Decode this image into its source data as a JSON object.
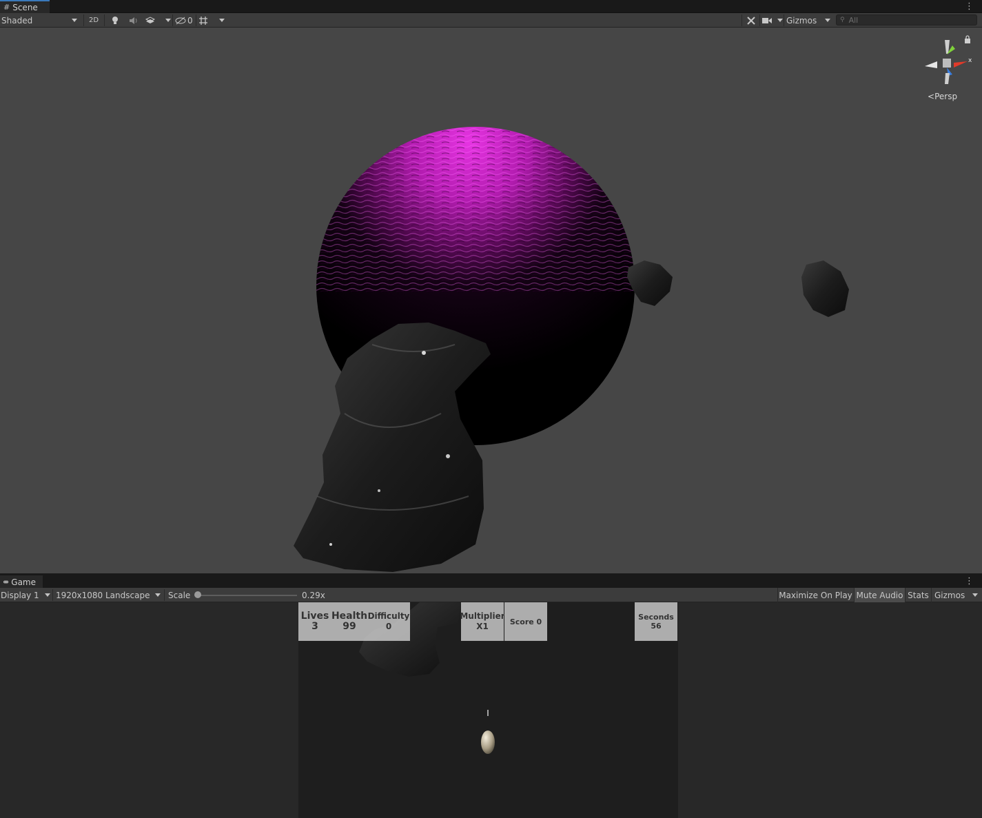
{
  "scene_panel": {
    "tab_label": "Scene",
    "toolbar": {
      "draw_mode": "Shaded",
      "mode_2d": "2D",
      "hidden_count": "0",
      "gizmos_label": "Gizmos",
      "search_placeholder": "All"
    },
    "view": {
      "projection_label": "Persp",
      "axis_x_label": "x"
    }
  },
  "game_panel": {
    "tab_label": "Game",
    "toolbar": {
      "display": "Display 1",
      "resolution": "1920x1080 Landscape",
      "scale_label": "Scale",
      "scale_value": "0.29x",
      "scale_slider_level": 0.0,
      "maximize_on_play": "Maximize On Play",
      "mute_audio": "Mute Audio",
      "stats": "Stats",
      "gizmos": "Gizmos"
    },
    "hud": {
      "lives_label": "Lives",
      "lives_value": "3",
      "health_label": "Health",
      "health_value": "99",
      "difficulty_label": "Difficulty",
      "difficulty_value": "0",
      "multiplier_label": "Multiplier",
      "multiplier_value": "X1",
      "score_text": "Score 0",
      "seconds_label": "Seconds",
      "seconds_value": "56"
    }
  },
  "colors": {
    "planet_highlight": "#e22de0",
    "scene_bg": "#464646",
    "toolbar_bg": "#3c3c3c",
    "tab_accent": "#3a79bb",
    "axis_x": "#e03a2a",
    "axis_y": "#7fd23a",
    "axis_z": "#3a7ee0"
  }
}
